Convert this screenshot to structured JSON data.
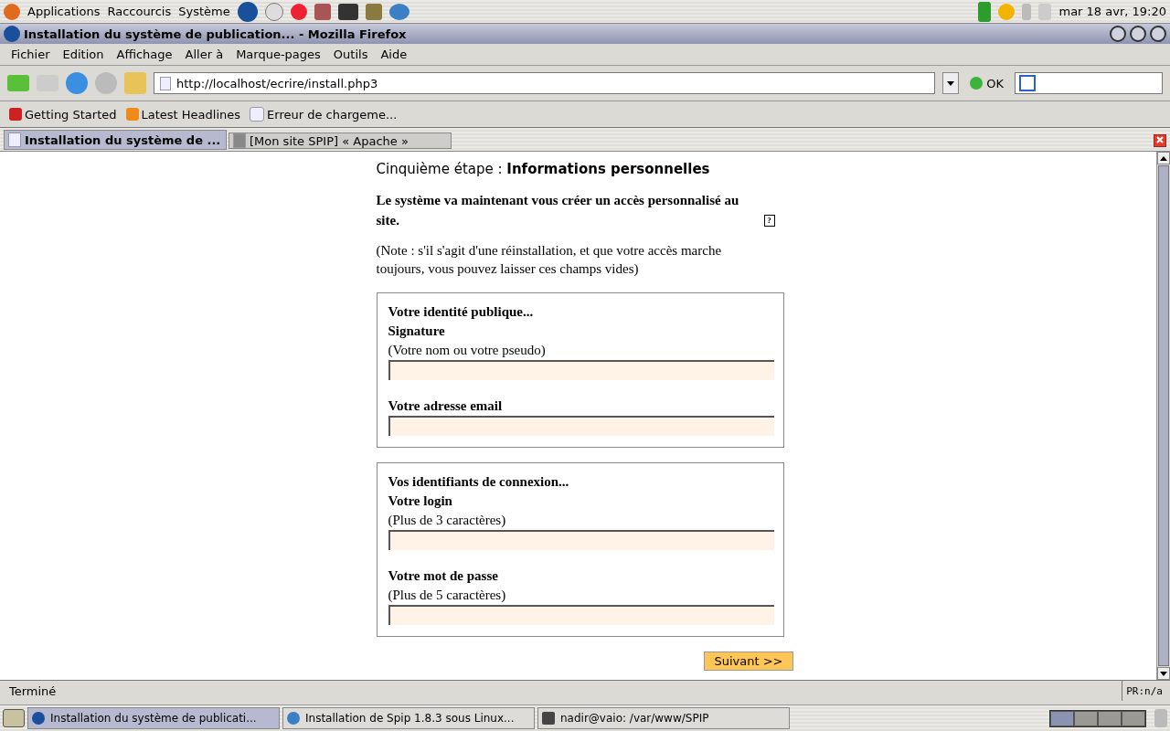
{
  "top_panel": {
    "menus": [
      "Applications",
      "Raccourcis",
      "Système"
    ],
    "clock": "mar 18 avr, 19:20"
  },
  "window": {
    "title": "Installation du système de publication... - Mozilla Firefox"
  },
  "menu": [
    "Fichier",
    "Edition",
    "Affichage",
    "Aller à",
    "Marque-pages",
    "Outils",
    "Aide"
  ],
  "toolbar": {
    "url": "http://localhost/ecrire/install.php3",
    "go": "OK"
  },
  "bookmarks": [
    "Getting Started",
    "Latest Headlines",
    "Erreur de chargeme..."
  ],
  "tabs": [
    {
      "label": "Installation du système de ...",
      "selected": true
    },
    {
      "label": "[Mon site SPIP] « Apache »",
      "selected": false
    }
  ],
  "page": {
    "step_label": "Cinquième étape :",
    "step_title": "Informations personnelles",
    "intro": "Le système va maintenant vous créer un accès personnalisé au site.",
    "help": "?",
    "note": "(Note : s'il s'agit d'une réinstallation, et que votre accès marche toujours, vous pouvez laisser ces champs vides)",
    "fieldsets": [
      {
        "legend": "Votre identité publique...",
        "fields": [
          {
            "label": "Signature",
            "hint": "(Votre nom ou votre pseudo)"
          },
          {
            "label": "Votre adresse email"
          }
        ]
      },
      {
        "legend": "Vos identifiants de connexion...",
        "fields": [
          {
            "label": "Votre login",
            "hint": "(Plus de 3 caractères)"
          },
          {
            "label": "Votre mot de passe",
            "hint": "(Plus de 5 caractères)"
          }
        ]
      }
    ],
    "submit": "Suivant >>"
  },
  "status_bar": {
    "text": "Terminé",
    "pr": "PR:n/a"
  },
  "taskbar": {
    "items": [
      {
        "label": "Installation du système de publicati...",
        "selected": true
      },
      {
        "label": "Installation de Spip 1.8.3 sous Linux...",
        "selected": false
      },
      {
        "label": "nadir@vaio: /var/www/SPIP",
        "selected": false
      }
    ],
    "workspaces": [
      {
        "selected": true
      },
      {
        "selected": false
      },
      {
        "selected": false
      },
      {
        "selected": false
      }
    ]
  }
}
